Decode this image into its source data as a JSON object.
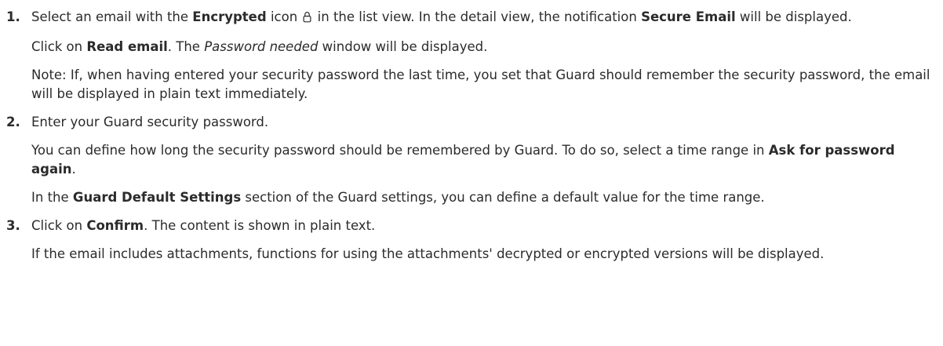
{
  "steps": [
    {
      "number": "1.",
      "p1": {
        "a": "Select an email with the ",
        "b": "Encrypted",
        "c": " icon ",
        "d": " in the list view. In the detail view, the notification ",
        "e": "Secure Email",
        "f": " will be displayed.",
        "icon": "lock-icon"
      },
      "p2": {
        "a": "Click on ",
        "b": "Read email",
        "c": ". The ",
        "d": "Password needed",
        "e": " window will be displayed."
      },
      "p3": "Note: If, when having entered your security password the last time, you set that Guard should remember the security password, the email will be displayed in plain text immediately."
    },
    {
      "number": "2.",
      "p1": "Enter your Guard security password.",
      "p2": {
        "a": "You can define how long the security password should be remembered by Guard. To do so, select a time range in ",
        "b": "Ask for password again",
        "c": "."
      },
      "p3": {
        "a": "In the ",
        "b": "Guard Default Settings",
        "c": " section of the Guard settings, you can define a default value for the time range."
      }
    },
    {
      "number": "3.",
      "p1": {
        "a": "Click on ",
        "b": "Confirm",
        "c": ". The content is shown in plain text."
      },
      "p2": "If the email includes attachments, functions for using the attachments' decrypted or encrypted versions will be displayed."
    }
  ]
}
